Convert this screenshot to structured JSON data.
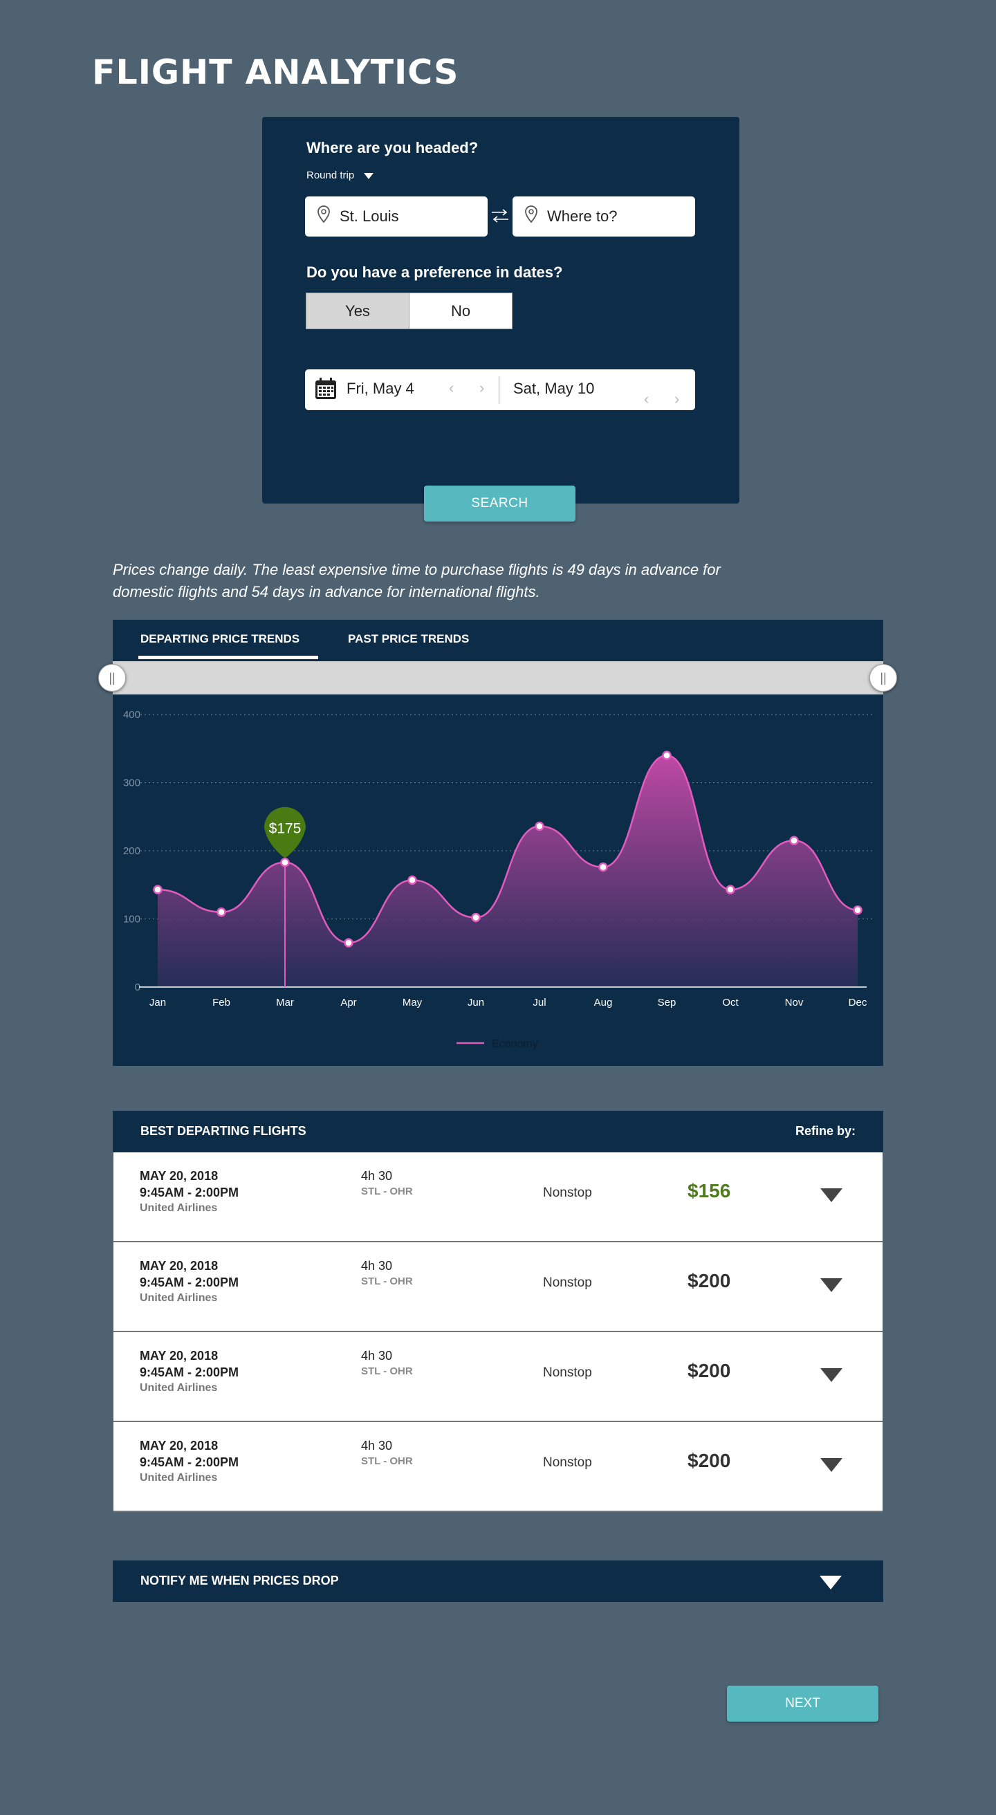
{
  "page": {
    "title": "FLIGHT ANALYTICS"
  },
  "search": {
    "destination_question": "Where are you headed?",
    "trip_type": "Round trip",
    "from_value": "St. Louis",
    "to_placeholder": "Where to?",
    "date_question": "Do you have a preference in dates?",
    "date_pref_yes": "Yes",
    "date_pref_no": "No",
    "date_pref_selected": "Yes",
    "depart_date": "Fri, May 4",
    "return_date": "Sat, May 10",
    "search_label": "SEARCH"
  },
  "info_text": "Prices change daily. The least expensive time to purchase flights is 49 days in advance for domestic flights and 54 days in advance for international flights.",
  "tabs": [
    {
      "label": "DEPARTING PRICE TRENDS",
      "active": true
    },
    {
      "label": "PAST PRICE TRENDS",
      "active": false
    }
  ],
  "range_handle_glyph": "||",
  "chart_data": {
    "type": "area",
    "categories": [
      "Jan",
      "Feb",
      "Mar",
      "Apr",
      "May",
      "Jun",
      "Jul",
      "Aug",
      "Sep",
      "Oct",
      "Nov",
      "Dec"
    ],
    "series": [
      {
        "name": "Economy",
        "values": [
          143,
          110,
          183,
          65,
          157,
          102,
          236,
          176,
          340,
          143,
          215,
          113
        ]
      }
    ],
    "ylim": [
      0,
      400
    ],
    "yticks": [
      0,
      100,
      200,
      300,
      400
    ],
    "grid": true,
    "legend": "bottom-center",
    "tooltip": {
      "category": "Mar",
      "label": "$175"
    },
    "line_color": "#e35bbf",
    "tooltip_color": "#4a7a12"
  },
  "flights": {
    "header": "BEST DEPARTING FLIGHTS",
    "refine_label": "Refine by:",
    "rows": [
      {
        "date": "MAY 20, 2018",
        "time": "9:45AM - 2:00PM",
        "airline": "United Airlines",
        "duration": "4h 30",
        "route": "STL - OHR",
        "stops": "Nonstop",
        "price": "$156",
        "best": true
      },
      {
        "date": "MAY 20, 2018",
        "time": "9:45AM - 2:00PM",
        "airline": "United Airlines",
        "duration": "4h 30",
        "route": "STL - OHR",
        "stops": "Nonstop",
        "price": "$200",
        "best": false
      },
      {
        "date": "MAY 20, 2018",
        "time": "9:45AM - 2:00PM",
        "airline": "United Airlines",
        "duration": "4h 30",
        "route": "STL - OHR",
        "stops": "Nonstop",
        "price": "$200",
        "best": false
      },
      {
        "date": "MAY 20, 2018",
        "time": "9:45AM - 2:00PM",
        "airline": "United Airlines",
        "duration": "4h 30",
        "route": "STL - OHR",
        "stops": "Nonstop",
        "price": "$200",
        "best": false
      }
    ]
  },
  "notify_label": "NOTIFY ME WHEN PRICES DROP",
  "next_label": "NEXT",
  "icons": {
    "pin": "location-pin-icon",
    "swap": "swap-arrows-icon",
    "calendar": "calendar-icon",
    "chevron_left": "‹",
    "chevron_right": "›"
  }
}
